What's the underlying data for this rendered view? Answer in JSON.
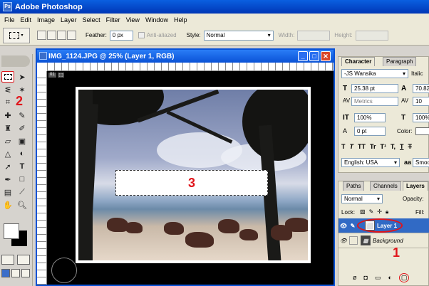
{
  "app": {
    "title": "Adobe Photoshop"
  },
  "menu": [
    "File",
    "Edit",
    "Image",
    "Layer",
    "Select",
    "Filter",
    "View",
    "Window",
    "Help"
  ],
  "options": {
    "feather_label": "Feather:",
    "feather_value": "0 px",
    "anti_aliased": "Anti-aliazed",
    "style_label": "Style:",
    "style_value": "Normal",
    "width_label": "Width:",
    "height_label": "Height:"
  },
  "document": {
    "title": "IMG_1124.JPG @ 25% (Layer 1, RGB)",
    "badge_left": "01",
    "badge_right": "⬚"
  },
  "annotations": {
    "one": "1",
    "two": "2",
    "three": "3"
  },
  "character_panel": {
    "tabs": [
      "Character",
      "Paragraph"
    ],
    "font_family": "-JS Wansika",
    "font_style": "Italic",
    "size": "25.38 pt",
    "leading": "70.82",
    "kerning": "Metrics",
    "tracking": "10",
    "vscale": "100%",
    "hscale": "100%",
    "baseline": "0 pt",
    "color_label": "Color:",
    "style_buttons": [
      "T",
      "T",
      "TT",
      "Tr",
      "T¹",
      "T,",
      "T",
      "T"
    ],
    "language": "English: USA",
    "aa_icon": "aa",
    "antialias": "Smoo"
  },
  "layers_panel": {
    "tabs": [
      "Paths",
      "Channels",
      "Layers"
    ],
    "blend_mode": "Normal",
    "opacity_label": "Opacity:",
    "lock_label": "Lock:",
    "fill_label": "Fill:",
    "layers": [
      {
        "name": "Layer 1",
        "selected": true
      },
      {
        "name": "Background",
        "selected": false
      }
    ]
  },
  "colors": {
    "titlebar": "#0a52d6",
    "selection": "#316ac5",
    "annotation_red": "#e0141a"
  }
}
